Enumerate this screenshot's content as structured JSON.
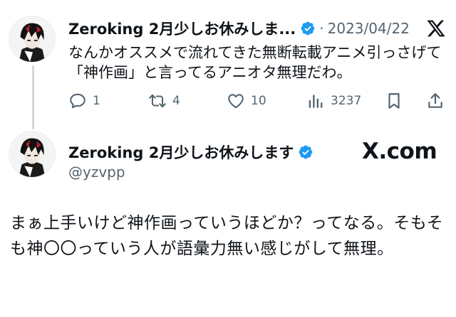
{
  "tweet": {
    "author_name": "Zeroking 2月少しお休みしま...",
    "separator": "·",
    "date": "2023/04/22",
    "text": "なんかオススメで流れてきた無断転載アニメ引っさげて「神作画」と言ってるアニオタ無理だわ。",
    "actions": {
      "reply_count": "1",
      "retweet_count": "4",
      "like_count": "10",
      "views_count": "3237"
    }
  },
  "quote": {
    "author_name": "Zeroking 2月少しお休みします",
    "handle": "@yzvpp",
    "source": "X.com",
    "text": "まぁ上手いけど神作画っていうほどか？ってなる。そもそも神〇〇っていう人が語彙力無い感じがして無理。"
  },
  "icons": {
    "verified": "verified-badge-icon",
    "x_logo": "x-logo-icon",
    "reply": "reply-icon",
    "retweet": "retweet-icon",
    "like": "heart-icon",
    "views": "views-icon",
    "bookmark": "bookmark-icon",
    "share": "share-icon"
  },
  "colors": {
    "text": "#0f1419",
    "secondary": "#536471",
    "verified": "#1d9bf0",
    "thread_line": "#cfd9de"
  }
}
